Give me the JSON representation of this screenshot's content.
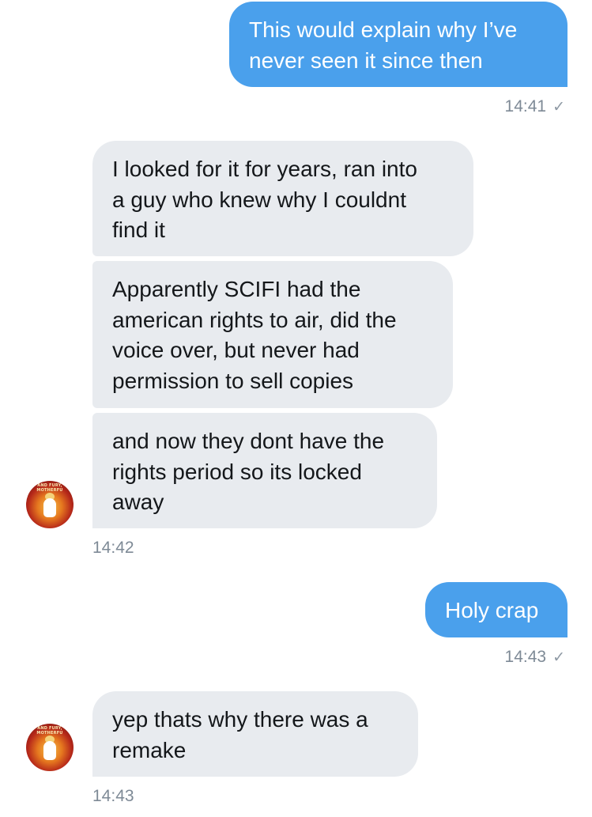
{
  "messages": [
    {
      "direction": "outgoing",
      "lines": [
        "This would explain why I’ve",
        "never seen it since then"
      ]
    },
    {
      "direction": "incoming",
      "lines": [
        "I looked for it for years, ran into",
        "a guy who knew why I couldnt",
        "find it"
      ]
    },
    {
      "direction": "incoming",
      "lines": [
        "Apparently SCIFI had the",
        "american rights to air, did the",
        "voice over, but never had",
        "permission to sell copies"
      ]
    },
    {
      "direction": "incoming",
      "lines": [
        "and now they dont have the",
        "rights period so its locked",
        "away"
      ]
    },
    {
      "direction": "outgoing",
      "lines": [
        "Holy crap"
      ]
    },
    {
      "direction": "incoming",
      "lines": [
        "yep thats why there was a",
        "remake"
      ]
    }
  ],
  "timestamps": {
    "t1": "14:41",
    "t2": "14:42",
    "t3": "14:43",
    "t4": "14:43"
  },
  "read_check": "✓",
  "avatar": {
    "caption": "AND FURY, MOTHERFU",
    "icon": "avatar-image"
  },
  "colors": {
    "outgoing_bubble": "#4aa0ec",
    "incoming_bubble": "#e8ebef",
    "timestamp": "#7e8a96"
  }
}
